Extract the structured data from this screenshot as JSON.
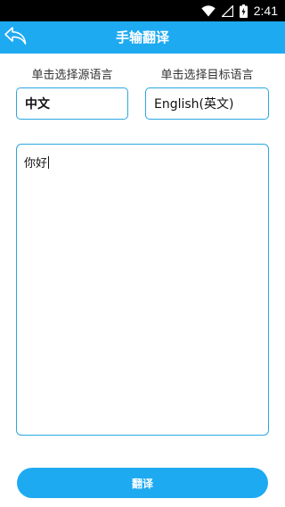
{
  "status_bar": {
    "time": "2:41",
    "icons": [
      "wifi-icon",
      "cellular-signal-icon",
      "battery-charging-icon"
    ]
  },
  "app_bar": {
    "title": "手输翻译",
    "back_icon": "back-arrow-icon",
    "color": "#1eaaf1"
  },
  "source_language": {
    "label": "单击选择源语言",
    "value": "中文"
  },
  "target_language": {
    "label": "单击选择目标语言",
    "value": "English(英文)"
  },
  "input": {
    "value": "你好"
  },
  "translate_button": {
    "label": "翻译"
  },
  "colors": {
    "accent": "#1eaaf1",
    "border": "#2aa7e0"
  }
}
